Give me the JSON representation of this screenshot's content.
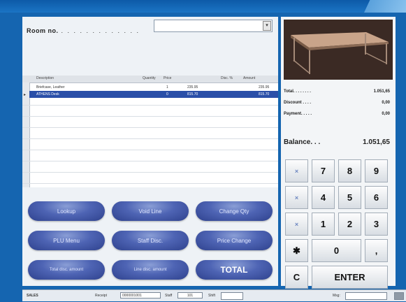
{
  "room": {
    "label": "Room no.",
    "dots": ". . . . . . . . . . . . .",
    "select_arrow": "▾"
  },
  "grid": {
    "columns": [
      "Description",
      "Quantity",
      "Price",
      "Disc. %",
      "Amount"
    ],
    "rows": [
      {
        "desc": "Briefcase, Leather",
        "qty": "1",
        "price": "235.95",
        "disc": "",
        "amount": "235.95",
        "marker": "",
        "selected": false
      },
      {
        "desc": "ATHENS Desk",
        "qty": "0",
        "price": "815.70",
        "disc": "",
        "amount": "815.70",
        "marker": "▸",
        "selected": true
      }
    ]
  },
  "buttons": [
    {
      "label": "Lookup"
    },
    {
      "label": "Void Line"
    },
    {
      "label": "Change Qty"
    },
    {
      "label": "PLU Menu"
    },
    {
      "label": "Staff Disc."
    },
    {
      "label": "Price Change"
    },
    {
      "label": "Total disc. amount"
    },
    {
      "label": "Line disc. amount"
    },
    {
      "label": "TOTAL"
    }
  ],
  "totals": {
    "total_label": "Total. . . . . . . .",
    "total_value": "1.051,65",
    "discount_label": "Discount . . . .",
    "discount_value": "0,00",
    "payment_label": "Payment. . . . .",
    "payment_value": "0,00",
    "balance_label": "Balance. . .",
    "balance_value": "1.051,65"
  },
  "keypad": {
    "op1": "×",
    "op2": "×",
    "op3": "×",
    "star": "✱",
    "clear": "C",
    "k7": "7",
    "k8": "8",
    "k9": "9",
    "k4": "4",
    "k5": "5",
    "k6": "6",
    "k1": "1",
    "k2": "2",
    "k3": "3",
    "k0": "0",
    "comma": ",",
    "enter": "ENTER"
  },
  "status": {
    "mode": "SALES",
    "receipt_label": "Receipt",
    "receipt_value": "0000001001",
    "staff_label": "Staff",
    "staff_value": "101",
    "shift_label": "Shift",
    "shift_value": "",
    "msg_label": "Msg:",
    "msg_value": ""
  },
  "colors": {
    "window_blue": "#1565b0",
    "pill_blue": "#4e64b4",
    "selected_row": "#2a4fa8"
  }
}
